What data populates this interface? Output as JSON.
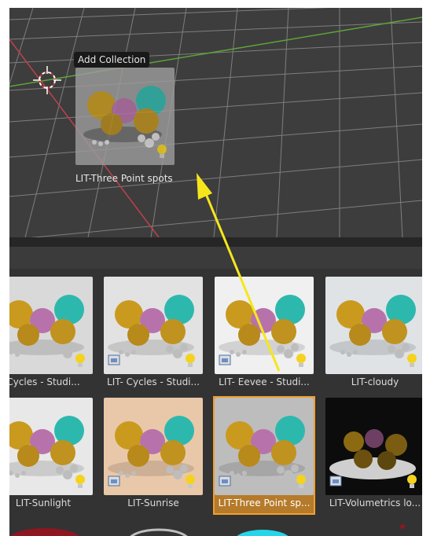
{
  "viewport": {
    "tooltip": "Add Collection",
    "drag_label": "LIT-Three Point spots"
  },
  "browser": {
    "assets": [
      {
        "label": "Cycles - Studi...",
        "background": "#d9d9d9",
        "kind": "bulb"
      },
      {
        "label": "LIT- Cycles - Studi...",
        "background": "#e2e2e2",
        "kind": "bulb-collection"
      },
      {
        "label": "LIT- Eevee - Studi...",
        "background": "#f0f0f0",
        "kind": "bulb-collection"
      },
      {
        "label": "LIT-cloudy",
        "background": "#dfe3e6",
        "kind": "bulb"
      },
      {
        "label": "LIT-Sunlight",
        "background": "#e8e8e8",
        "kind": "bulb"
      },
      {
        "label": "LIT-Sunrise",
        "background": "#e9c8a9",
        "kind": "bulb-collection"
      },
      {
        "label": "LIT-Three Point sp...",
        "background": "#bdbdbd",
        "kind": "bulb-collection",
        "selected": true
      },
      {
        "label": "LIT-Volumetrics lo...",
        "background": "#0c0c0c",
        "kind": "bulb-collection"
      }
    ]
  },
  "colors": {
    "selection": "#f0a030",
    "arrow": "#f5e61c",
    "x_axis": "#c0404a",
    "y_axis": "#5da23a"
  }
}
